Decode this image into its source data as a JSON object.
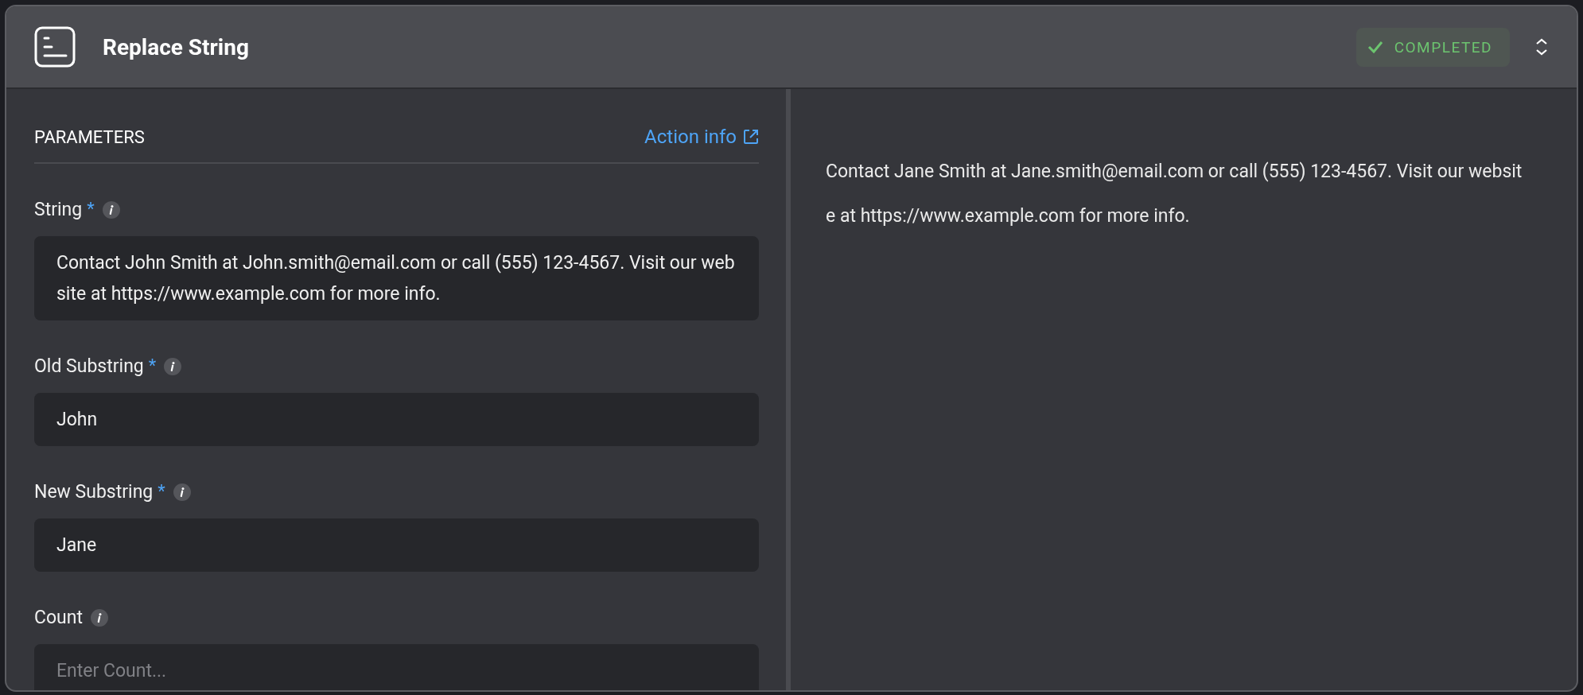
{
  "header": {
    "title": "Replace String",
    "status": {
      "label": "COMPLETED",
      "kind": "completed"
    }
  },
  "parameters": {
    "heading": "PARAMETERS",
    "link": "Action info"
  },
  "fields": [
    {
      "label": "String",
      "marker": "*",
      "value": "Contact John Smith at John.smith@email.com or call (555) 123-4567. Visit our website at https://www.example.com for more info."
    },
    {
      "label": "Old Substring",
      "marker": "*",
      "value": "John"
    },
    {
      "label": "New Substring",
      "marker": "*",
      "value": "Jane"
    },
    {
      "label": "Count",
      "placeholder": "Enter Count..."
    }
  ],
  "output": {
    "text": "Contact Jane Smith at Jane.smith@email.com or call (555) 123-4567. Visit our website at https://www.example.com for more info."
  }
}
